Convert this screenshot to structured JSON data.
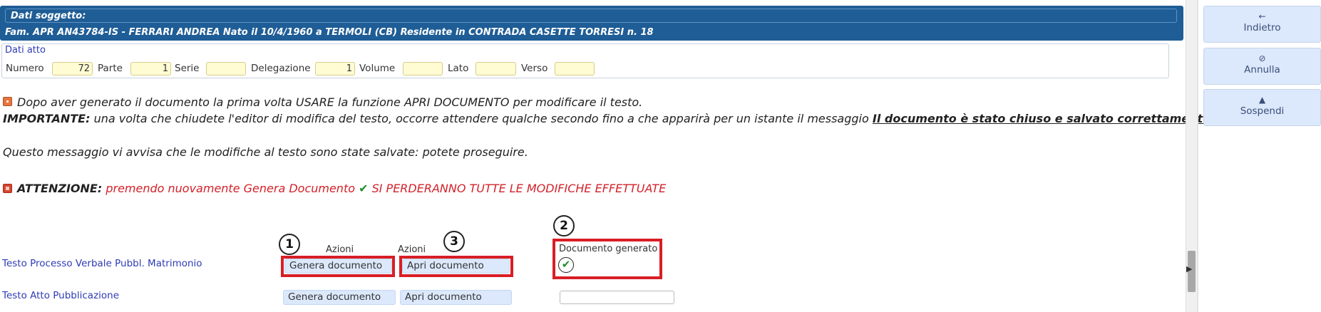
{
  "subject": {
    "title": "Dati soggetto:",
    "line": "Fam. APR AN43784-IS - FERRARI ANDREA Nato il 10/4/1960 a TERMOLI (CB) Residente in CONTRADA CASETTE TORRESI n. 18"
  },
  "dati_atto": {
    "title": "Dati atto",
    "fields": {
      "numero": {
        "label": "Numero",
        "value": "72"
      },
      "parte": {
        "label": "Parte",
        "value": "1"
      },
      "serie": {
        "label": "Serie",
        "value": ""
      },
      "delegazione": {
        "label": "Delegazione",
        "value": "1"
      },
      "volume": {
        "label": "Volume",
        "value": ""
      },
      "lato": {
        "label": "Lato",
        "value": ""
      },
      "verso": {
        "label": "Verso",
        "value": ""
      }
    }
  },
  "messages": {
    "line1": "Dopo aver generato il documento la prima volta USARE la funzione APRI DOCUMENTO per modificare il testo.",
    "important_label": "IMPORTANTE:",
    "important_text": " una volta che chiudete l'editor di modifica del testo, occorre attendere qualche secondo fino a che apparirà per un istante il messaggio ",
    "important_emph": "Il documento è stato chiuso e salvato correttamente.",
    "line3": "Questo messaggio vi avvisa che le modifiche al testo sono state salvate: potete proseguire.",
    "attention_label": "ATTENZIONE:",
    "attention_text1": " premendo nuovamente Genera Documento ",
    "attention_text2": " SI PERDERANNO TUTTE LE MODIFICHE EFFETTUATE"
  },
  "table": {
    "col_azioni_1": "Azioni",
    "col_azioni_2": "Azioni",
    "col_documento": "Documento generato",
    "rows": [
      {
        "label": "Testo Processo Verbale Pubbl. Matrimonio",
        "genera": "Genera documento",
        "apri": "Apri documento"
      },
      {
        "label": "Testo Atto Pubblicazione",
        "genera": "Genera documento",
        "apri": "Apri documento"
      }
    ]
  },
  "annotations": {
    "n1": "1",
    "n2": "2",
    "n3": "3"
  },
  "sidebar": {
    "back": {
      "icon": "arrow-left-icon",
      "label": "Indietro"
    },
    "cancel": {
      "icon": "cancel-circle-icon",
      "label": "Annulla"
    },
    "suspend": {
      "icon": "warning-icon",
      "label": "Sospendi"
    }
  },
  "colors": {
    "header_bg": "#1f5d96",
    "button_bg": "#dce8fb",
    "annotation_red": "#d81e26",
    "warning_red": "#d3222a",
    "check_green": "#1f8f2d"
  }
}
